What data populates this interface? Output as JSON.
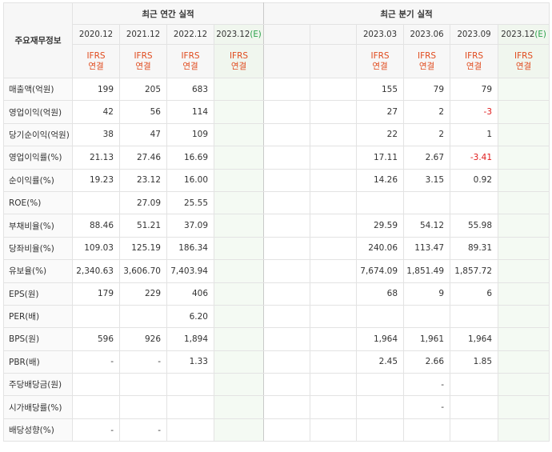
{
  "headers": {
    "corner": "주요재무정보",
    "annual_title": "최근 연간 실적",
    "quarterly_title": "최근 분기 실적",
    "annual_periods": [
      "2020.12",
      "2021.12",
      "2022.12",
      "2023.12"
    ],
    "quarterly_periods": [
      "",
      "",
      "2023.03",
      "2023.06",
      "2023.09",
      "2023.12"
    ],
    "estimate_mark": "(E)",
    "ifrs_line1": "IFRS",
    "ifrs_line2": "연결"
  },
  "rows": [
    {
      "label": "매출액(억원)",
      "annual": [
        "199",
        "205",
        "683",
        ""
      ],
      "quarterly": [
        "",
        "",
        "155",
        "79",
        "79",
        ""
      ]
    },
    {
      "label": "영업이익(억원)",
      "annual": [
        "42",
        "56",
        "114",
        ""
      ],
      "quarterly": [
        "",
        "",
        "27",
        "2",
        "-3",
        ""
      ]
    },
    {
      "label": "당기순이익(억원)",
      "annual": [
        "38",
        "47",
        "109",
        ""
      ],
      "quarterly": [
        "",
        "",
        "22",
        "2",
        "1",
        ""
      ]
    },
    {
      "label": "영업이익률(%)",
      "annual": [
        "21.13",
        "27.46",
        "16.69",
        ""
      ],
      "quarterly": [
        "",
        "",
        "17.11",
        "2.67",
        "-3.41",
        ""
      ]
    },
    {
      "label": "순이익률(%)",
      "annual": [
        "19.23",
        "23.12",
        "16.00",
        ""
      ],
      "quarterly": [
        "",
        "",
        "14.26",
        "3.15",
        "0.92",
        ""
      ]
    },
    {
      "label": "ROE(%)",
      "annual": [
        "",
        "27.09",
        "25.55",
        ""
      ],
      "quarterly": [
        "",
        "",
        "",
        "",
        "",
        ""
      ]
    },
    {
      "label": "부채비율(%)",
      "annual": [
        "88.46",
        "51.21",
        "37.09",
        ""
      ],
      "quarterly": [
        "",
        "",
        "29.59",
        "54.12",
        "55.98",
        ""
      ]
    },
    {
      "label": "당좌비율(%)",
      "annual": [
        "109.03",
        "125.19",
        "186.34",
        ""
      ],
      "quarterly": [
        "",
        "",
        "240.06",
        "113.47",
        "89.31",
        ""
      ]
    },
    {
      "label": "유보율(%)",
      "annual": [
        "2,340.63",
        "3,606.70",
        "7,403.94",
        ""
      ],
      "quarterly": [
        "",
        "",
        "7,674.09",
        "1,851.49",
        "1,857.72",
        ""
      ]
    },
    {
      "label": "EPS(원)",
      "annual": [
        "179",
        "229",
        "406",
        ""
      ],
      "quarterly": [
        "",
        "",
        "68",
        "9",
        "6",
        ""
      ]
    },
    {
      "label": "PER(배)",
      "annual": [
        "",
        "",
        "6.20",
        ""
      ],
      "quarterly": [
        "",
        "",
        "",
        "",
        "",
        ""
      ]
    },
    {
      "label": "BPS(원)",
      "annual": [
        "596",
        "926",
        "1,894",
        ""
      ],
      "quarterly": [
        "",
        "",
        "1,964",
        "1,961",
        "1,964",
        ""
      ]
    },
    {
      "label": "PBR(배)",
      "annual": [
        "-",
        "-",
        "1.33",
        ""
      ],
      "quarterly": [
        "",
        "",
        "2.45",
        "2.66",
        "1.85",
        ""
      ]
    },
    {
      "label": "주당배당금(원)",
      "annual": [
        "",
        "",
        "",
        ""
      ],
      "quarterly": [
        "",
        "",
        "",
        "-",
        "",
        ""
      ]
    },
    {
      "label": "시가배당률(%)",
      "annual": [
        "",
        "",
        "",
        ""
      ],
      "quarterly": [
        "",
        "",
        "",
        "-",
        "",
        ""
      ]
    },
    {
      "label": "배당성향(%)",
      "annual": [
        "-",
        "-",
        "",
        ""
      ],
      "quarterly": [
        "",
        "",
        "",
        "",
        "",
        ""
      ]
    }
  ],
  "colors": {
    "ifrs": "#e04b1e",
    "negative": "#e01b1b",
    "estimate_bg": "#f4faf3",
    "estimate_mark": "#2aa14a"
  }
}
